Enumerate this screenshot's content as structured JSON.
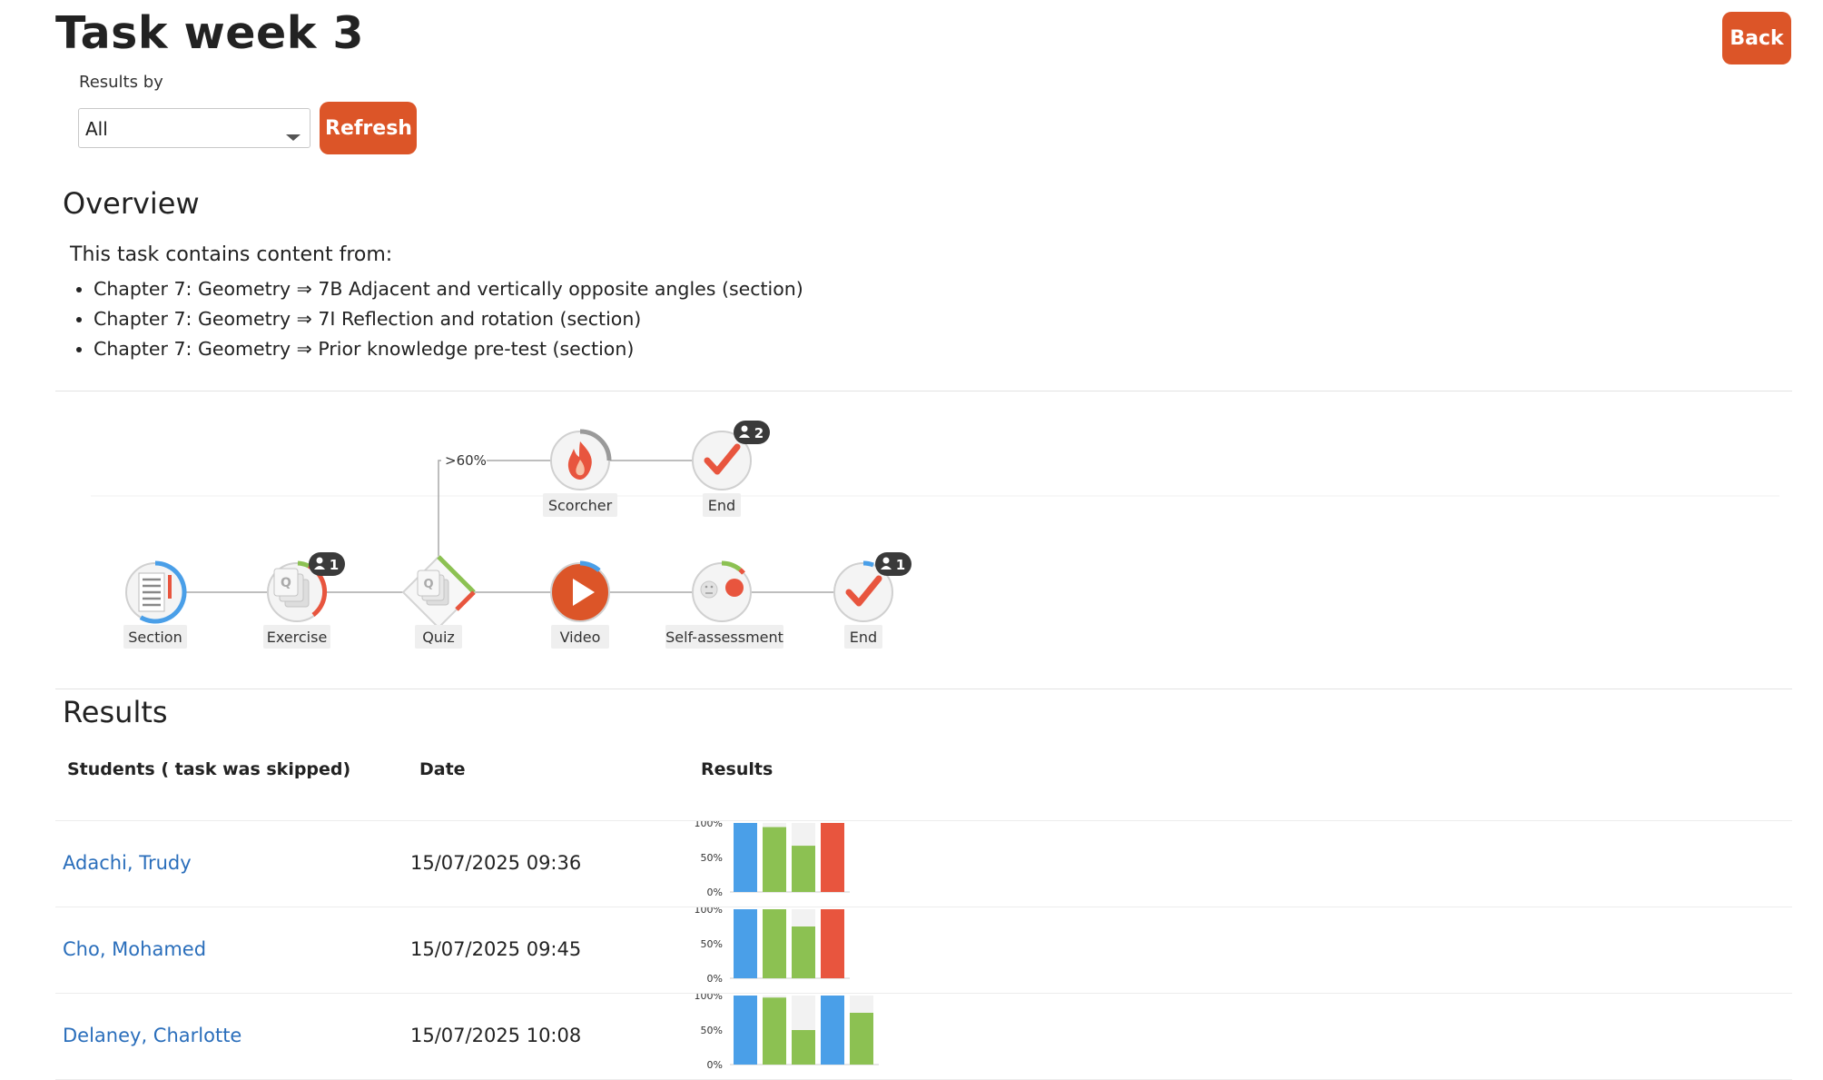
{
  "page": {
    "title": "Task week 3",
    "back_label": "Back",
    "results_by_label": "Results by",
    "results_by_selected": "All",
    "refresh_label": "Refresh"
  },
  "overview": {
    "heading": "Overview",
    "intro": "This task contains content from:",
    "items": [
      "Chapter 7: Geometry ⇒ 7B Adjacent and vertically opposite angles (section)",
      "Chapter 7: Geometry ⇒ 7I Reflection and rotation (section)",
      "Chapter 7: Geometry ⇒ Prior knowledge pre-test (section)"
    ]
  },
  "flow": {
    "branch_label": ">60%",
    "nodes": [
      {
        "id": "section",
        "label": "Section",
        "icon": "section-icon",
        "badge": null
      },
      {
        "id": "exercise",
        "label": "Exercise",
        "icon": "question-cards-icon",
        "badge": "1"
      },
      {
        "id": "quiz",
        "label": "Quiz",
        "icon": "question-cards-icon",
        "badge": null
      },
      {
        "id": "video",
        "label": "Video",
        "icon": "play-icon",
        "badge": null
      },
      {
        "id": "self-assessment",
        "label": "Self-assessment",
        "icon": "self-assessment-icon",
        "badge": null
      },
      {
        "id": "end-main",
        "label": "End",
        "icon": "checkmark-icon",
        "badge": "1"
      },
      {
        "id": "scorcher",
        "label": "Scorcher",
        "icon": "flame-icon",
        "badge": null
      },
      {
        "id": "end-branch",
        "label": "End",
        "icon": "checkmark-icon",
        "badge": "2"
      }
    ],
    "colors": {
      "blue": "#4a9fe8",
      "green": "#8cc152",
      "red": "#e8553e",
      "orange": "#dc5528",
      "gray": "#b0b0b0"
    }
  },
  "results": {
    "heading": "Results",
    "columns": [
      "Students ( task was skipped)",
      "Date",
      "Results"
    ],
    "rows": [
      {
        "student": "Adachi, Trudy",
        "date": "15/07/2025 09:36"
      },
      {
        "student": "Cho, Mohamed",
        "date": "15/07/2025 09:45"
      },
      {
        "student": "Delaney, Charlotte",
        "date": "15/07/2025 10:08"
      }
    ]
  },
  "chart_data": [
    {
      "type": "bar",
      "y_tick_labels": [
        "100%",
        "50%",
        "0%"
      ],
      "ylim": [
        0,
        100
      ],
      "bars": [
        {
          "value": 100,
          "color": "#4a9fe8"
        },
        {
          "value": 94,
          "color": "#8cc152"
        },
        {
          "value": 67,
          "color": "#8cc152"
        },
        {
          "value": 100,
          "color": "#e8553e"
        }
      ]
    },
    {
      "type": "bar",
      "y_tick_labels": [
        "100%",
        "50%",
        "0%"
      ],
      "ylim": [
        0,
        100
      ],
      "bars": [
        {
          "value": 100,
          "color": "#4a9fe8"
        },
        {
          "value": 100,
          "color": "#8cc152"
        },
        {
          "value": 75,
          "color": "#8cc152"
        },
        {
          "value": 100,
          "color": "#e8553e"
        }
      ]
    },
    {
      "type": "bar",
      "y_tick_labels": [
        "100%",
        "50%",
        "0%"
      ],
      "ylim": [
        0,
        100
      ],
      "bars": [
        {
          "value": 100,
          "color": "#4a9fe8"
        },
        {
          "value": 97,
          "color": "#8cc152"
        },
        {
          "value": 50,
          "color": "#8cc152"
        },
        {
          "value": 100,
          "color": "#4a9fe8"
        },
        {
          "value": 75,
          "color": "#8cc152"
        }
      ]
    }
  ]
}
